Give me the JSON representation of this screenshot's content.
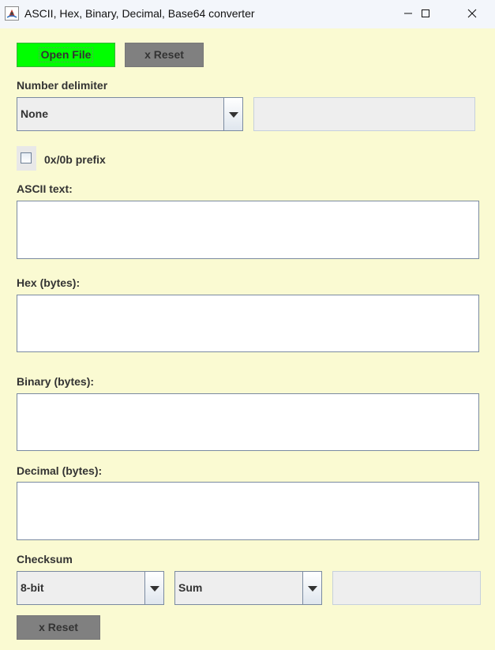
{
  "window": {
    "title": "ASCII, Hex, Binary, Decimal, Base64 converter",
    "icon": "java-app-icon",
    "controls": [
      "minimize-icon",
      "maximize-icon",
      "close-icon"
    ]
  },
  "toolbar": {
    "open_file_label": "Open File",
    "reset_label": "x Reset"
  },
  "delimiter": {
    "label": "Number delimiter",
    "selected": "None",
    "custom_value": ""
  },
  "prefix": {
    "label": "0x/0b prefix",
    "checked": false
  },
  "fields": {
    "ascii_label": "ASCII text:",
    "ascii_value": "",
    "hex_label": "Hex (bytes):",
    "hex_value": "",
    "binary_label": "Binary (bytes):",
    "binary_value": "",
    "decimal_label": "Decimal (bytes):",
    "decimal_value": ""
  },
  "checksum": {
    "label": "Checksum",
    "bits_selected": "8-bit",
    "method_selected": "Sum",
    "result": "",
    "reset_label": "x Reset"
  },
  "colors": {
    "background": "#fafad2",
    "open_button": "#00ff00",
    "reset_button": "#808080",
    "titlebar": "#f3f6fb"
  }
}
